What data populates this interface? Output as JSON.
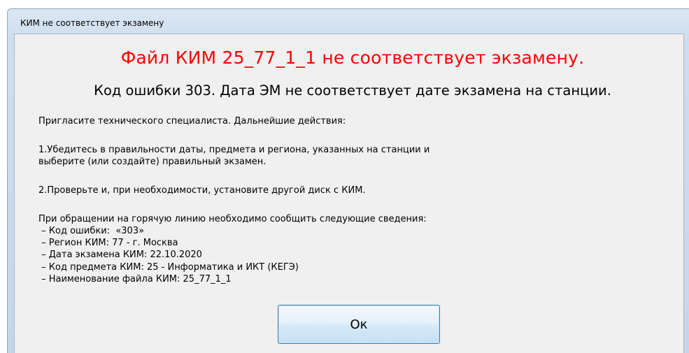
{
  "window": {
    "title": "КИМ не соответствует экзамену"
  },
  "dialog": {
    "headline": "Файл КИМ 25_77_1_1 не соответствует экзамену.",
    "error_line": "Код ошибки 303. Дата ЭМ не соответствует дате экзамена на станции.",
    "intro": "Пригласите технического специалиста. Дальнейшие действия:",
    "step1_line1": "1.Убедитесь в правильности даты, предмета и региона, указанных на станции и",
    "step1_line2": "выберите (или создайте) правильный экзамен.",
    "step2": "2.Проверьте и, при необходимости, установите другой диск с КИМ.",
    "hotline_intro": "При обращении на горячую линию необходимо сообщить следующие сведения:",
    "details": [
      " – Код ошибки:  «303»",
      " – Регион КИМ: 77 - г. Москва",
      " – Дата экзамена КИМ: 22.10.2020",
      " – Код предмета КИМ: 25 - Информатика и ИКТ (КЕГЭ)",
      " – Наименование файла КИМ: 25_77_1_1"
    ],
    "ok_label": "Ок"
  },
  "colors": {
    "headline": "#ff0000",
    "client_background": "#f0f0f0",
    "frame": "#cfdeee"
  }
}
